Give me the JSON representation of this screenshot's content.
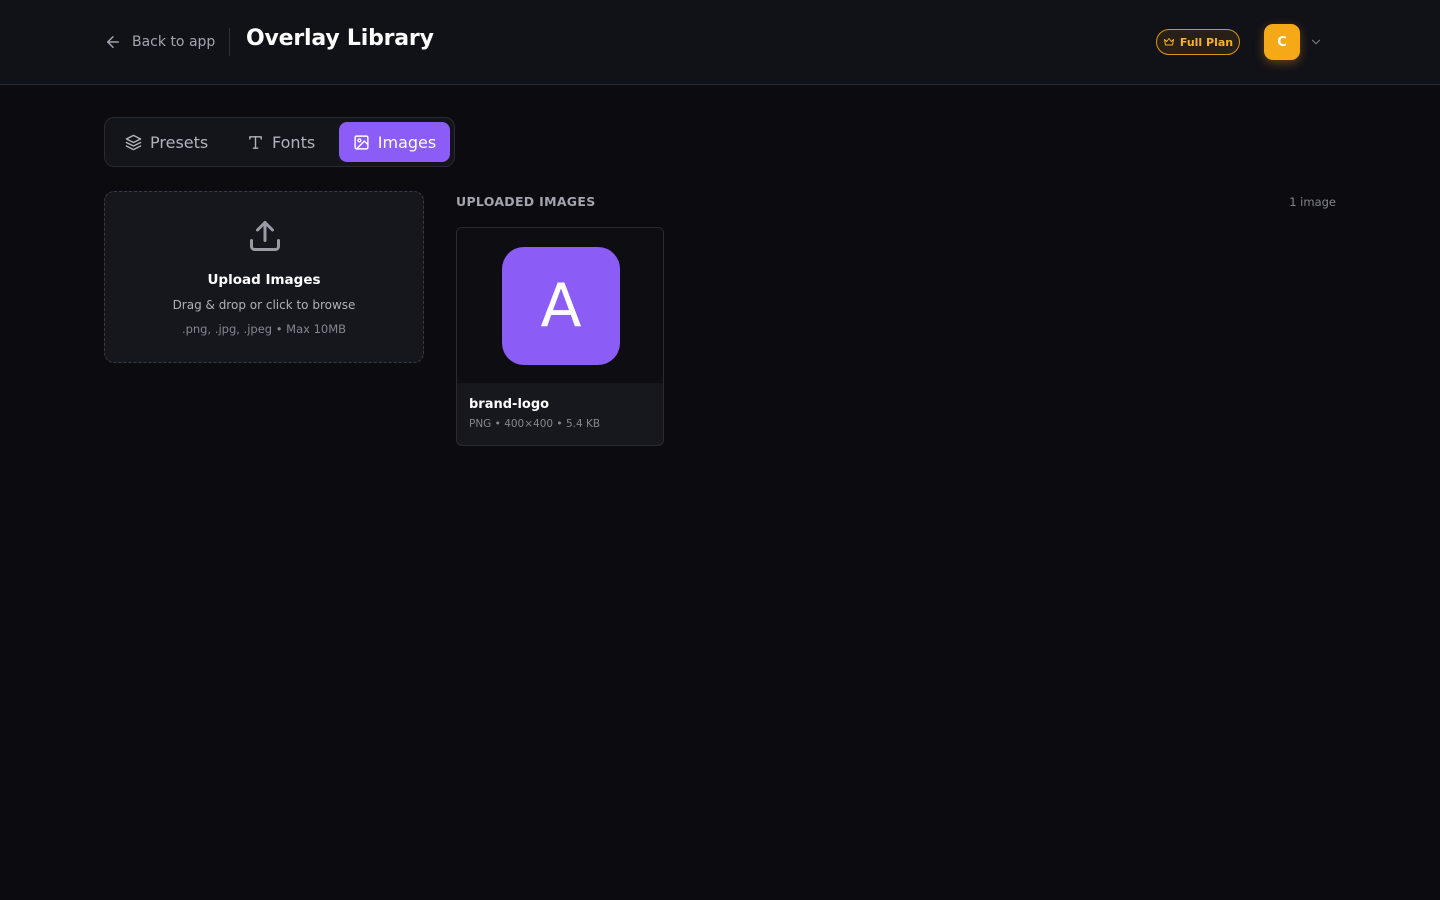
{
  "header": {
    "back_label": "Back to app",
    "title": "Overlay Library",
    "plan_badge": "Full Plan",
    "avatar_initial": "C"
  },
  "tabs": [
    {
      "label": "Presets",
      "icon": "layers-icon",
      "active": false
    },
    {
      "label": "Fonts",
      "icon": "type-icon",
      "active": false
    },
    {
      "label": "Images",
      "icon": "image-icon",
      "active": true
    }
  ],
  "upload": {
    "title": "Upload Images",
    "hint": "Drag & drop or click to browse",
    "formats": ".png, .jpg, .jpeg • Max 10MB"
  },
  "library": {
    "section_title": "UPLOADED IMAGES",
    "count": "1 image",
    "images": [
      {
        "name": "brand-logo",
        "meta": "PNG • 400×400 • 5.4 KB",
        "thumb_letter": "A"
      }
    ]
  },
  "colors": {
    "accent": "#8b5cf6",
    "plan": "#f5b12a",
    "avatar": "#f6a917",
    "background": "#0b0b10"
  }
}
